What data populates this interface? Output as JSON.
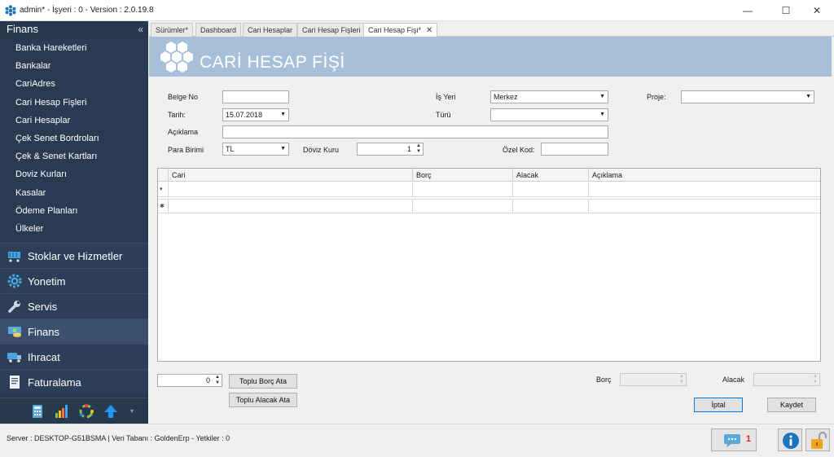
{
  "window": {
    "title": "admin* - İşyeri : 0 - Version : 2.0.19.8",
    "controls": {
      "minimize": "—",
      "maximize": "☐",
      "close": "✕"
    }
  },
  "sidebar": {
    "header": "Finans",
    "collapse_glyph": "«",
    "items": [
      "Banka Hareketleri",
      "Bankalar",
      "CariAdres",
      "Cari Hesap Fişleri",
      "Cari Hesaplar",
      "Çek Senet Bordroları",
      "Çek & Senet Kartları",
      "Doviz Kurları",
      "Kasalar",
      "Ödeme Planları",
      "Ülkeler"
    ],
    "groups": [
      {
        "label": "Stoklar ve Hizmetler",
        "icon": "cart-icon"
      },
      {
        "label": "Yonetim",
        "icon": "gear-icon"
      },
      {
        "label": "Servis",
        "icon": "wrench-icon"
      },
      {
        "label": "Finans",
        "icon": "money-icon"
      },
      {
        "label": "Ihracat",
        "icon": "truck-icon"
      },
      {
        "label": "Faturalama",
        "icon": "document-icon"
      }
    ],
    "footer_icons": [
      "calculator-icon",
      "bar-chart-icon",
      "refresh-icon",
      "up-arrow-icon"
    ],
    "footer_more": "▾"
  },
  "tabs": [
    {
      "label": "Sürümler*"
    },
    {
      "label": "Dashboard"
    },
    {
      "label": "Cari Hesaplar"
    },
    {
      "label": "Cari Hesap Fişleri"
    },
    {
      "label": "Cari Hesap Fişi*",
      "active": true,
      "close": "✕"
    }
  ],
  "form": {
    "title": "CARİ HESAP FİŞİ",
    "belge_no": {
      "label": "Belge No",
      "value": ""
    },
    "tarih": {
      "label": "Tarih:",
      "value": "15.07.2018"
    },
    "aciklama": {
      "label": "Açıklama",
      "value": ""
    },
    "para_birimi": {
      "label": "Para Birimi",
      "value": "TL"
    },
    "doviz_kuru": {
      "label": "Döviz Kuru",
      "value": "1"
    },
    "is_yeri": {
      "label": "İş Yeri",
      "value": "Merkez"
    },
    "turu": {
      "label": "Türü",
      "value": ""
    },
    "ozel_kod": {
      "label": "Özel Kod:",
      "value": ""
    },
    "proje": {
      "label": "Proje:",
      "value": ""
    }
  },
  "grid": {
    "columns": [
      "Cari",
      "Borç",
      "Alacak",
      "Açıklama"
    ],
    "row_indicator": "▾",
    "new_row_indicator": "✱"
  },
  "footer": {
    "counter_value": "0",
    "toplu_borc": "Toplu Borç Ata",
    "toplu_alacak": "Toplu Alacak Ata",
    "borc_label": "Borç",
    "alacak_label": "Alacak",
    "iptal": "İptal",
    "kaydet": "Kaydet"
  },
  "statusbar": {
    "text": "Server : DESKTOP-G51BSMA   |   Veri Tabanı : GoldenErp   - Yetkiler : 0",
    "notification_count": "1",
    "accent": "#d9232d"
  }
}
